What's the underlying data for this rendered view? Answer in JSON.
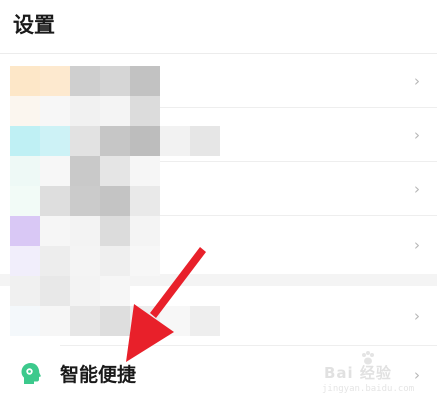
{
  "header": {
    "title": "设置"
  },
  "rows": [
    {
      "chevron": "›"
    },
    {
      "chevron": "›"
    },
    {
      "chevron": "›"
    },
    {
      "chevron": "›"
    },
    {
      "chevron": "›"
    }
  ],
  "smart_convenience": {
    "label": "智能便捷",
    "icon": "head-profile-icon",
    "icon_color": "#3cc98c",
    "chevron": "›"
  },
  "watermark": {
    "main": "Bai 经验",
    "sub": "jingyan.baidu.com"
  },
  "colors": {
    "annotation_arrow": "#e8202a",
    "chevron": "#b7b7b7"
  }
}
